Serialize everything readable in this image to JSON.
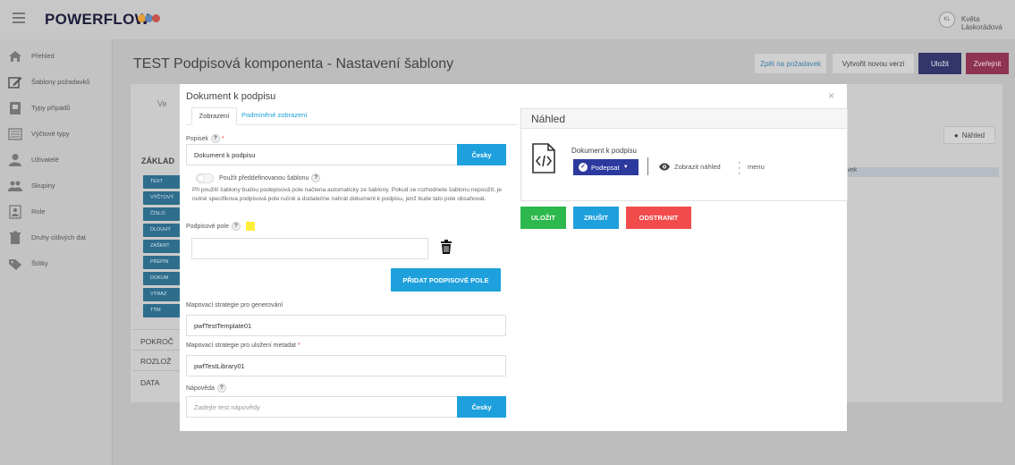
{
  "app": {
    "brand": "POWERFLOW",
    "brand_dot_colors": [
      "#f3a21e",
      "#4a90e2",
      "#e94a3a"
    ],
    "user_initials": "KL",
    "user_name": "Květa Láskorádová"
  },
  "sidebar": {
    "items": [
      {
        "label": "Přehled",
        "icon": "home-icon"
      },
      {
        "label": "Šablony požadavků",
        "icon": "edit-icon"
      },
      {
        "label": "Typy případů",
        "icon": "case-icon"
      },
      {
        "label": "Výčtové typy",
        "icon": "list-icon"
      },
      {
        "label": "Uživatelé",
        "icon": "user-icon"
      },
      {
        "label": "Skupiny",
        "icon": "group-icon"
      },
      {
        "label": "Role",
        "icon": "role-icon"
      },
      {
        "label": "Druhy citlivých dat",
        "icon": "trash-bin-icon"
      },
      {
        "label": "Štítky",
        "icon": "tag-icon"
      }
    ]
  },
  "page": {
    "title": "TEST Podpisová komponenta - Nastavení šablony",
    "buttons": {
      "back": "Zpět na požadavek",
      "new_version": "Vytvořit novou verzi",
      "save": "Uložit",
      "publish": "Zveřejnit"
    }
  },
  "background": {
    "ve_label": "Ve",
    "nahled_button": "Náhled",
    "zaklad": "ZÁKLAD",
    "row_text": "rvek",
    "chips": [
      "TEXT",
      "VÝČTOVÝ",
      "ČÍSLO",
      "DLOUHÝ",
      "ZAŠKRT",
      "PŘEPÍN",
      "DOKUM",
      "VÝRAZ",
      "TÝM"
    ],
    "sections": [
      "POKROČ",
      "ROZLOŽ",
      "DATA"
    ]
  },
  "modal": {
    "title": "Dokument k podpisu",
    "close": "×",
    "tabs": [
      "Zobrazení",
      "Podmíněné zobrazení"
    ],
    "popisek_label": "Popisek",
    "popisek_value": "Dokument k podpisu",
    "lang_button": "Česky",
    "toggle_label": "Použít předdefinovanou šablonu",
    "info_text": "Při použití šablony budou podepisová pole načtena automaticky ze šablony. Pokud se rozhodnete šablonu nepoužít, je nutné specifikova podpisová pole ručně a dodatečne nahrát dokument k podpisu, jenž bude tato pole obsahovat.",
    "signature_label": "Podpisové pole",
    "signature_value": "",
    "add_signature_button": "PŘIDAT PODPISOVÉ POLE",
    "mapping_gen_label": "Mapovací strategie pro generování",
    "mapping_gen_value": "pwfTestTemplate01",
    "mapping_save_label": "Mapovací strategie pro uložení metadat",
    "mapping_save_value": "pwfTestLibrary01",
    "napoveda_label": "Nápověda",
    "napoveda_placeholder": "Zadejte test nápovědy",
    "help_mark": "?",
    "required_mark": "*"
  },
  "preview": {
    "title": "Náhled",
    "doc_name": "Dokument k podpisu",
    "sign_button": "Podepsat",
    "show_preview": "Zobrazit náhled",
    "menu": "menu"
  },
  "actions": {
    "save": "ULOŽIT",
    "cancel": "ZRUŠIT",
    "remove": "ODSTRANIT"
  },
  "colors": {
    "primary_blue": "#1ea0dc",
    "dark_blue": "#2c3a9e",
    "save_green": "#2db84d",
    "cancel_blue": "#1ea0dc",
    "remove_red": "#f24b4b",
    "publish_pink": "#c2245a"
  }
}
